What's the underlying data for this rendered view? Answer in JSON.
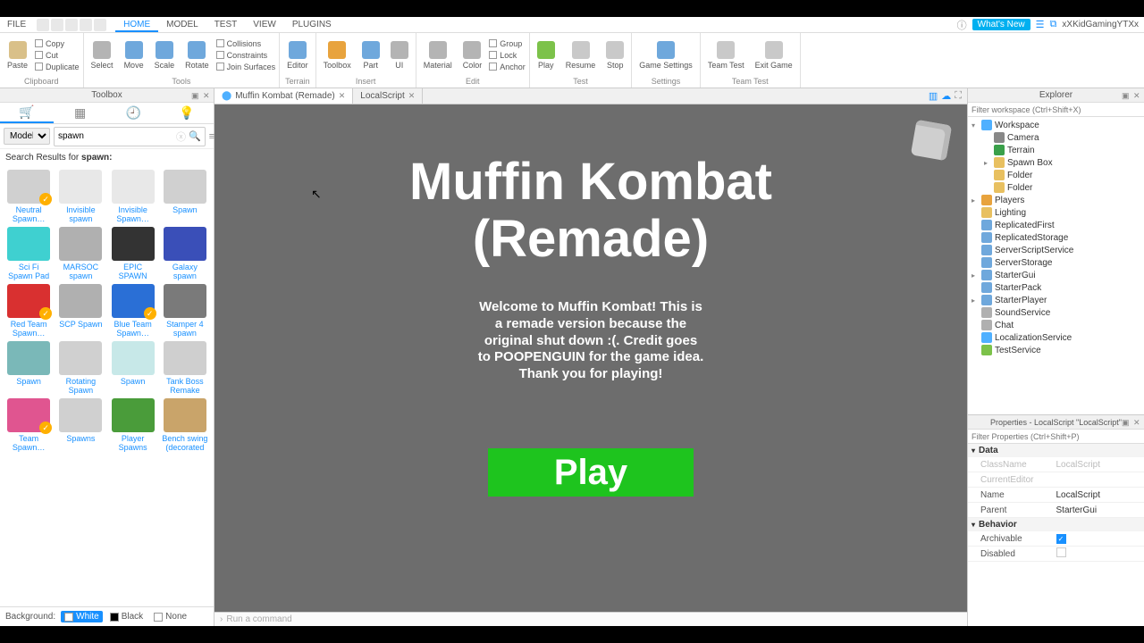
{
  "menu": {
    "file": "FILE",
    "tabs": [
      "HOME",
      "MODEL",
      "TEST",
      "VIEW",
      "PLUGINS"
    ],
    "active": 0,
    "whatsnew": "What's New",
    "user": "xXKidGamingYTXx"
  },
  "ribbon": {
    "groups": [
      {
        "label": "Clipboard",
        "big": [
          {
            "lbl": "Paste",
            "c": "#d9c089"
          }
        ],
        "small": [
          "Copy",
          "Cut",
          "Duplicate"
        ]
      },
      {
        "label": "Tools",
        "big": [
          {
            "lbl": "Select",
            "c": "#b4b4b4"
          },
          {
            "lbl": "Move",
            "c": "#6fa8dc"
          },
          {
            "lbl": "Scale",
            "c": "#6fa8dc"
          },
          {
            "lbl": "Rotate",
            "c": "#6fa8dc"
          }
        ],
        "small": [
          "Collisions",
          "Constraints",
          "Join Surfaces"
        ]
      },
      {
        "label": "Terrain",
        "big": [
          {
            "lbl": "Editor",
            "c": "#6fa8dc"
          }
        ]
      },
      {
        "label": "Insert",
        "big": [
          {
            "lbl": "Toolbox",
            "c": "#e8a33d"
          },
          {
            "lbl": "Part",
            "c": "#6fa8dc"
          },
          {
            "lbl": "UI",
            "c": "#b4b4b4"
          }
        ]
      },
      {
        "label": "Edit",
        "big": [
          {
            "lbl": "Material",
            "c": "#b4b4b4"
          },
          {
            "lbl": "Color",
            "c": "#b4b4b4"
          }
        ],
        "small": [
          "Group",
          "Lock",
          "Anchor"
        ]
      },
      {
        "label": "Test",
        "big": [
          {
            "lbl": "Play",
            "c": "#7cc24a"
          },
          {
            "lbl": "Resume",
            "c": "#c9c9c9"
          },
          {
            "lbl": "Stop",
            "c": "#c9c9c9"
          }
        ]
      },
      {
        "label": "Settings",
        "big": [
          {
            "lbl": "Game Settings",
            "c": "#6fa8dc"
          }
        ]
      },
      {
        "label": "Team Test",
        "big": [
          {
            "lbl": "Team Test",
            "c": "#c9c9c9"
          },
          {
            "lbl": "Exit Game",
            "c": "#c9c9c9"
          }
        ]
      }
    ]
  },
  "toolbox": {
    "title": "Toolbox",
    "dropdown": "Models",
    "search": "spawn",
    "results_pre": "Search Results for ",
    "results_term": "spawn:",
    "items": [
      {
        "n": "Neutral Spawn…",
        "c": "#d0d0d0",
        "b": true
      },
      {
        "n": "Invisible spawn",
        "c": "#e8e8e8"
      },
      {
        "n": "Invisible Spawn…",
        "c": "#e8e8e8"
      },
      {
        "n": "Spawn",
        "c": "#d0d0d0"
      },
      {
        "n": "Sci Fi Spawn Pad",
        "c": "#3fd0d0"
      },
      {
        "n": "MARSOC spawn",
        "c": "#b0b0b0"
      },
      {
        "n": "EPIC SPAWN",
        "c": "#333333"
      },
      {
        "n": "Galaxy spawn",
        "c": "#3a4fb8"
      },
      {
        "n": "Red Team Spawn…",
        "c": "#d93030",
        "b": true
      },
      {
        "n": "SCP Spawn",
        "c": "#b0b0b0"
      },
      {
        "n": "Blue Team Spawn…",
        "c": "#2a6fd6",
        "b": true
      },
      {
        "n": "Stamper 4 spawn",
        "c": "#7a7a7a"
      },
      {
        "n": "Spawn",
        "c": "#7ab8b8"
      },
      {
        "n": "Rotating Spawn",
        "c": "#d0d0d0"
      },
      {
        "n": "Spawn",
        "c": "#c7e8e8"
      },
      {
        "n": "Tank Boss Remake",
        "c": "#cfcfcf"
      },
      {
        "n": "Team Spawn…",
        "c": "#e05590",
        "b": true
      },
      {
        "n": "Spawns",
        "c": "#d0d0d0"
      },
      {
        "n": "Player Spawns",
        "c": "#4a9c3a"
      },
      {
        "n": "Bench swing (decorated",
        "c": "#c9a46a"
      }
    ],
    "bg_label": "Background:",
    "bg_opts": [
      "White",
      "Black",
      "None"
    ],
    "bg_sel": 0
  },
  "docs": {
    "tabs": [
      {
        "n": "Muffin Kombat (Remade)",
        "active": true
      },
      {
        "n": "LocalScript"
      }
    ]
  },
  "viewport": {
    "title1": "Muffin Kombat",
    "title2": "(Remade)",
    "desc": "Welcome to Muffin Kombat! This is a remade version because the original shut down :(. Credit goes to POOPENGUIN for the game idea. Thank you for playing!",
    "play": "Play"
  },
  "explorer": {
    "title": "Explorer",
    "filter_ph": "Filter workspace (Ctrl+Shift+X)",
    "tree": [
      {
        "d": 0,
        "tw": "▾",
        "n": "Workspace",
        "c": "#4fb0ff"
      },
      {
        "d": 1,
        "tw": "",
        "n": "Camera",
        "c": "#888"
      },
      {
        "d": 1,
        "tw": "",
        "n": "Terrain",
        "c": "#3aa04a"
      },
      {
        "d": 1,
        "tw": "▸",
        "n": "Spawn Box",
        "c": "#e8c060"
      },
      {
        "d": 1,
        "tw": "",
        "n": "Folder",
        "c": "#e8c060"
      },
      {
        "d": 1,
        "tw": "",
        "n": "Folder",
        "c": "#e8c060"
      },
      {
        "d": 0,
        "tw": "▸",
        "n": "Players",
        "c": "#e8a33d"
      },
      {
        "d": 0,
        "tw": "",
        "n": "Lighting",
        "c": "#e8c060"
      },
      {
        "d": 0,
        "tw": "",
        "n": "ReplicatedFirst",
        "c": "#6fa8dc"
      },
      {
        "d": 0,
        "tw": "",
        "n": "ReplicatedStorage",
        "c": "#6fa8dc"
      },
      {
        "d": 0,
        "tw": "",
        "n": "ServerScriptService",
        "c": "#6fa8dc"
      },
      {
        "d": 0,
        "tw": "",
        "n": "ServerStorage",
        "c": "#6fa8dc"
      },
      {
        "d": 0,
        "tw": "▸",
        "n": "StarterGui",
        "c": "#6fa8dc"
      },
      {
        "d": 0,
        "tw": "",
        "n": "StarterPack",
        "c": "#6fa8dc"
      },
      {
        "d": 0,
        "tw": "▸",
        "n": "StarterPlayer",
        "c": "#6fa8dc"
      },
      {
        "d": 0,
        "tw": "",
        "n": "SoundService",
        "c": "#b0b0b0"
      },
      {
        "d": 0,
        "tw": "",
        "n": "Chat",
        "c": "#b0b0b0"
      },
      {
        "d": 0,
        "tw": "",
        "n": "LocalizationService",
        "c": "#4fb0ff"
      },
      {
        "d": 0,
        "tw": "",
        "n": "TestService",
        "c": "#7cc24a"
      }
    ]
  },
  "properties": {
    "title": "Properties - LocalScript \"LocalScript\"",
    "filter_ph": "Filter Properties (Ctrl+Shift+P)",
    "cats": [
      {
        "n": "Data",
        "rows": [
          {
            "k": "ClassName",
            "v": "LocalScript",
            "dim": true
          },
          {
            "k": "CurrentEditor",
            "v": "",
            "dim": true
          },
          {
            "k": "Name",
            "v": "LocalScript"
          },
          {
            "k": "Parent",
            "v": "StarterGui"
          }
        ]
      },
      {
        "n": "Behavior",
        "rows": [
          {
            "k": "Archivable",
            "v": "check"
          },
          {
            "k": "Disabled",
            "v": "uncheck"
          }
        ]
      }
    ]
  },
  "cmd": {
    "ph": "Run a command"
  }
}
